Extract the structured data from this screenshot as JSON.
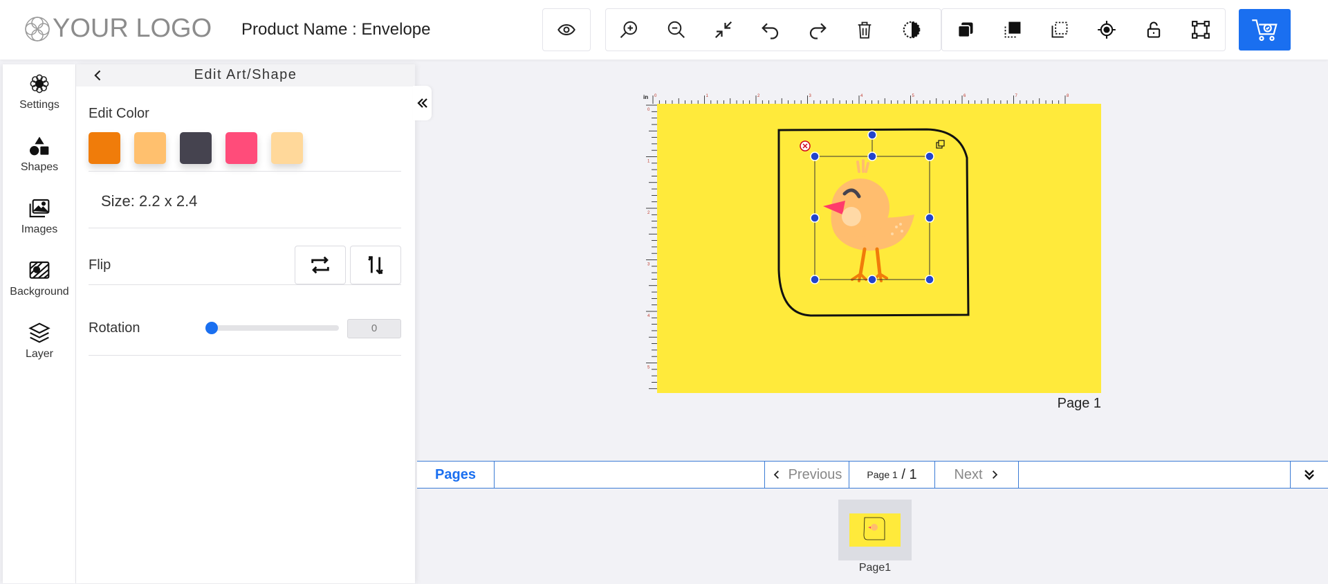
{
  "header": {
    "logo_text": "YOUR LOGO",
    "product_label": "Product Name : Envelope"
  },
  "toolbar": {
    "preview_icon": "eye-icon",
    "edit_tools": [
      "zoom-in-icon",
      "zoom-out-icon",
      "fit-to-screen-icon",
      "undo-icon",
      "redo-icon",
      "delete-icon",
      "contrast-icon"
    ],
    "arrange_tools": [
      "bring-front-icon",
      "send-back-icon",
      "select-area-icon",
      "center-target-icon",
      "unlock-icon",
      "crop-box-icon"
    ],
    "cart_icon": "cart-icon",
    "cart_color": "#1a6ff0"
  },
  "sidebar": {
    "items": [
      {
        "label": "Settings",
        "icon": "settings-icon"
      },
      {
        "label": "Shapes",
        "icon": "shapes-icon"
      },
      {
        "label": "Images",
        "icon": "images-icon"
      },
      {
        "label": "Background",
        "icon": "background-icon"
      },
      {
        "label": "Layer",
        "icon": "layer-icon"
      }
    ]
  },
  "panel": {
    "title": "Edit Art/Shape",
    "edit_color_label": "Edit Color",
    "colors": [
      "#f07c0a",
      "#ffc06e",
      "#45434f",
      "#ff4c7a",
      "#ffd89a"
    ],
    "size_text": "Size: 2.2 x 2.4",
    "flip_label": "Flip",
    "rotation_label": "Rotation",
    "rotation_value": "0"
  },
  "canvas": {
    "background_color": "#ffea3b",
    "ruler_unit": "in",
    "ruler_ticks_top": [
      "0",
      "1",
      "2",
      "3",
      "4",
      "5",
      "6",
      "7",
      "8"
    ],
    "ruler_ticks_left": [
      "0",
      "1",
      "2",
      "3",
      "4",
      "5"
    ],
    "page_caption": "Page 1"
  },
  "pages": {
    "tab_label": "Pages",
    "prev_label": "Previous",
    "next_label": "Next",
    "page_small": "Page 1",
    "page_sep": " / ",
    "page_total": "1",
    "thumbs": [
      {
        "label": "Page1"
      }
    ]
  }
}
